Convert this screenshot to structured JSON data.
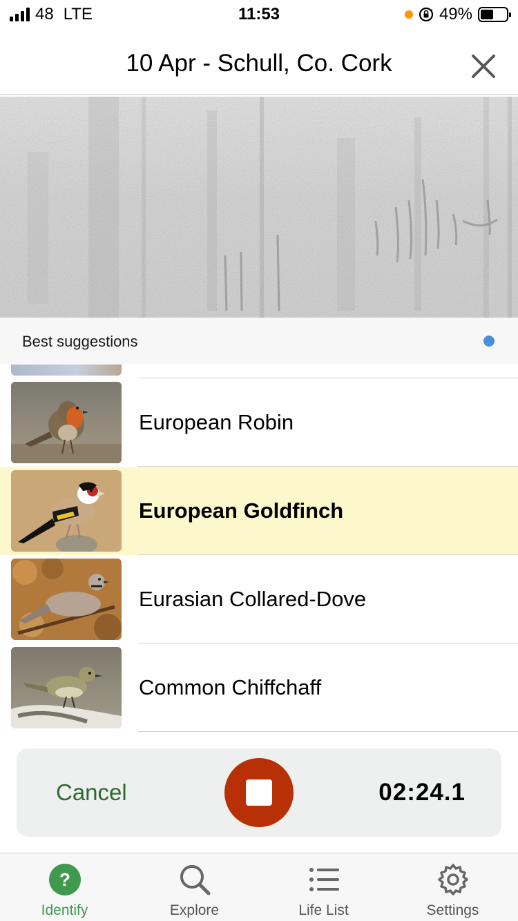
{
  "status_bar": {
    "signal": "48",
    "network": "LTE",
    "time": "11:53",
    "battery_percent": "49%",
    "battery_level": 0.49
  },
  "header": {
    "title": "10 Apr - Schull, Co. Cork"
  },
  "suggestions": {
    "title": "Best suggestions",
    "items": [
      {
        "name": "European Robin",
        "highlighted": false
      },
      {
        "name": "European Goldfinch",
        "highlighted": true
      },
      {
        "name": "Eurasian Collared-Dove",
        "highlighted": false
      },
      {
        "name": "Common Chiffchaff",
        "highlighted": false
      }
    ]
  },
  "recording": {
    "cancel_label": "Cancel",
    "timer": "02:24.1"
  },
  "tabs": [
    {
      "label": "Identify",
      "icon": "question-icon",
      "active": true
    },
    {
      "label": "Explore",
      "icon": "search-icon",
      "active": false
    },
    {
      "label": "Life List",
      "icon": "list-icon",
      "active": false
    },
    {
      "label": "Settings",
      "icon": "gear-icon",
      "active": false
    }
  ],
  "colors": {
    "accent_green": "#3f9a4e",
    "cancel_green": "#2d6b33",
    "record_red": "#b83005",
    "highlight_yellow": "#fdf8cc",
    "indicator_blue": "#4a8fdb"
  }
}
